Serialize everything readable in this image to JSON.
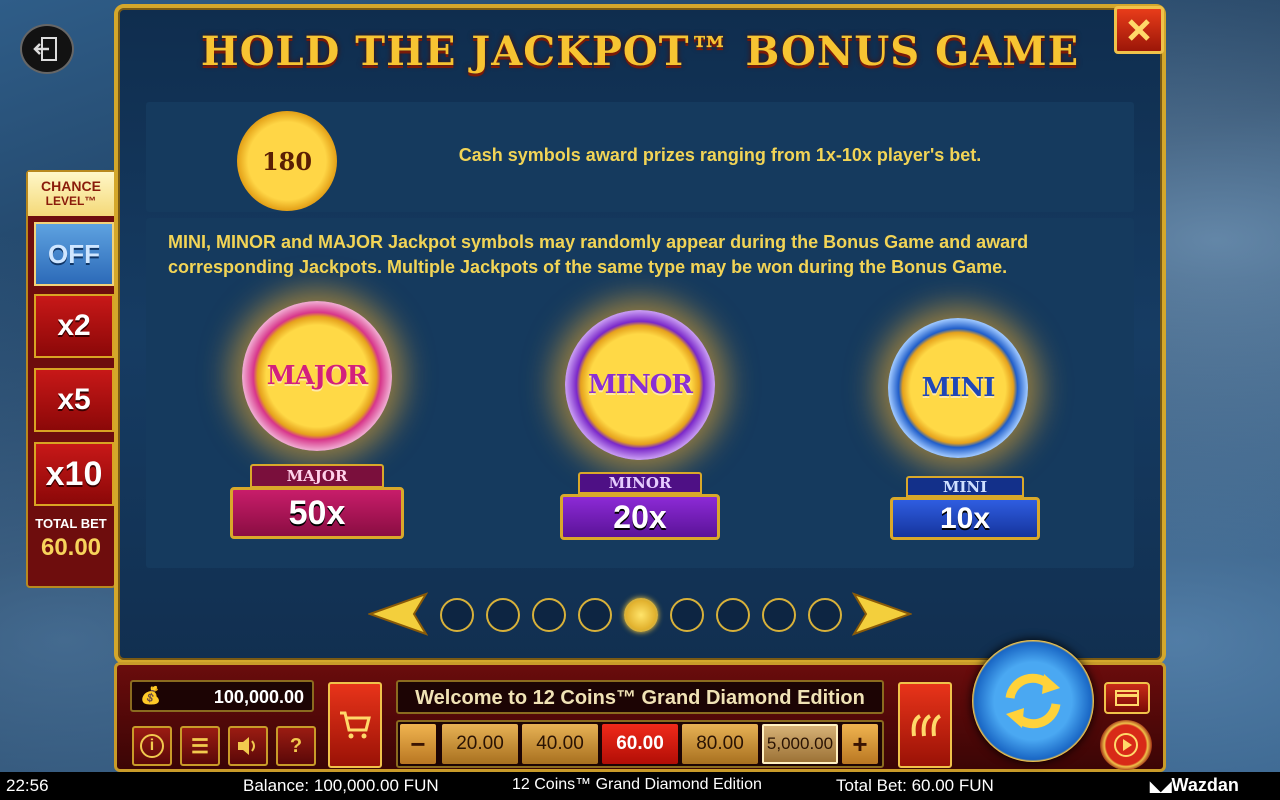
{
  "popup": {
    "title": "HOLD THE JACKPOT™ BONUS GAME",
    "cash_text": "Cash symbols award prizes ranging from 1x-10x player's bet.",
    "cash_coin_value": "180",
    "jackpot_text_line1": "MINI, MINOR and MAJOR Jackpot symbols may randomly appear during the Bonus Game and award",
    "jackpot_text_line2": "corresponding Jackpots. Multiple Jackpots of the same type may be won during the Bonus Game.",
    "jackpots": [
      {
        "coin_label": "MAJOR",
        "plaque_label": "MAJOR",
        "multiplier": "50x"
      },
      {
        "coin_label": "MINOR",
        "plaque_label": "MINOR",
        "multiplier": "20x"
      },
      {
        "coin_label": "MINI",
        "plaque_label": "MINI",
        "multiplier": "10x"
      }
    ],
    "pagination": {
      "total_pages": 9,
      "current_page": 5
    }
  },
  "chance_level": {
    "title_line1": "CHANCE",
    "title_line2": "LEVEL™",
    "options": [
      "OFF",
      "x2",
      "x5",
      "x10"
    ],
    "selected": "OFF",
    "total_bet_label": "TOTAL BET",
    "total_bet_value": "60.00"
  },
  "controls": {
    "balance_value": "100,000.00",
    "message": "Welcome to 12 Coins™ Grand Diamond Edition",
    "bets": [
      "20.00",
      "40.00",
      "60.00",
      "80.00",
      "5,000.00"
    ],
    "selected_bet": "60.00",
    "minus": "−",
    "plus": "+",
    "info": "i",
    "menu": "☰",
    "help": "?"
  },
  "status_bar": {
    "time": "22:56",
    "balance": "Balance: 100,000.00 FUN",
    "game_name": "12 Coins™ Grand Diamond Edition",
    "total_bet": "Total Bet: 60.00 FUN",
    "brand": "Wazdan"
  },
  "colors": {
    "gold": "#f7c432",
    "panel_blue": "#153a5e",
    "bar_red": "#6a0c0c"
  }
}
